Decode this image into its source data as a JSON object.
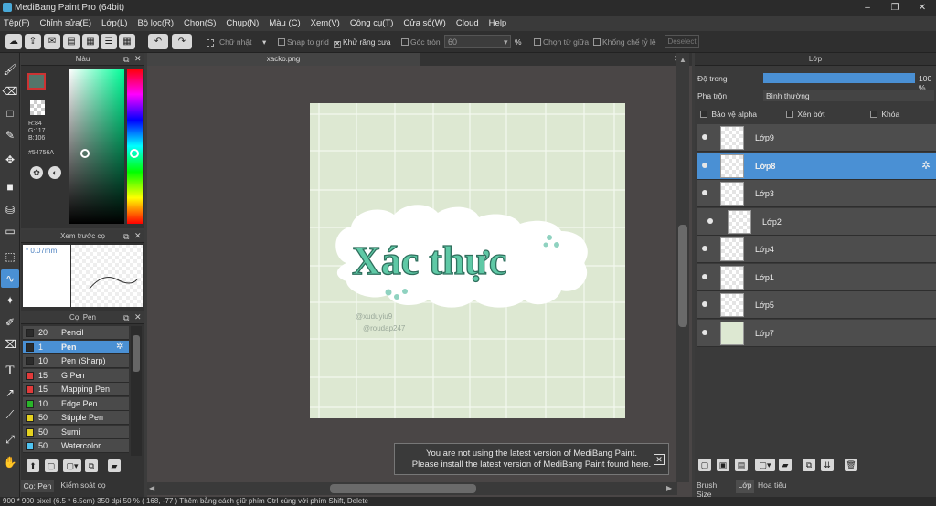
{
  "window": {
    "title": "MediBang Paint Pro (64bit)"
  },
  "menu": [
    "Tệp(F)",
    "Chỉnh sửa(E)",
    "Lớp(L)",
    "Bộ lọc(R)",
    "Chọn(S)",
    "Chụp(N)",
    "Màu (C)",
    "Xem(V)",
    "Công cụ(T)",
    "Cửa sổ(W)",
    "Cloud",
    "Help"
  ],
  "toolbar": {
    "shape": "Chữ nhật",
    "snap": "Snap to grid",
    "antialias": "Khử răng cưa",
    "corner": "Góc tròn",
    "corner_value": "60",
    "corner_unit": "%",
    "center": "Chọn từ giữa",
    "ratio": "Khống chế tỷ lệ",
    "deselect": "Deselect"
  },
  "color_panel": {
    "title": "Màu",
    "r": "R:84",
    "g": "G:117",
    "b": "B:106",
    "hex": "#54756A",
    "current_color": "#54756a"
  },
  "preview_panel": {
    "title": "Xem trước cọ",
    "size": "0.07mm"
  },
  "brush_panel": {
    "title": "Cọ: Pen",
    "brushes": [
      {
        "size": "20",
        "name": "Pencil",
        "color": "#2b2b2b"
      },
      {
        "size": "1",
        "name": "Pen",
        "color": "#2b2b2b",
        "selected": true
      },
      {
        "size": "10",
        "name": "Pen (Sharp)",
        "color": "#2b2b2b"
      },
      {
        "size": "15",
        "name": "G Pen",
        "color": "#e23a3a"
      },
      {
        "size": "15",
        "name": "Mapping Pen",
        "color": "#e23a3a"
      },
      {
        "size": "10",
        "name": "Edge Pen",
        "color": "#29b529"
      },
      {
        "size": "50",
        "name": "Stipple Pen",
        "color": "#e5d21f"
      },
      {
        "size": "50",
        "name": "Sumi",
        "color": "#e5d21f"
      },
      {
        "size": "50",
        "name": "Watercolor",
        "color": "#4fc3f0"
      }
    ],
    "tabs": [
      "Cọ: Pen",
      "Kiểm soát cọ"
    ]
  },
  "canvas": {
    "tab": "xacko.png",
    "artwork_text": "Xác thực",
    "handles": [
      "@xuduyiu9",
      "@roudap247"
    ],
    "notice_line1": "You are not using the latest version of MediBang Paint.",
    "notice_line2": "Please install the latest version of MediBang Paint found here."
  },
  "layer_panel": {
    "title": "Lớp",
    "opacity_label": "Độ trong",
    "opacity_value": "100 %",
    "opacity": 1.0,
    "blend_label": "Pha trộn",
    "blend_value": "Bình thường",
    "protect_alpha": "Bảo vệ alpha",
    "clipping": "Xén bớt",
    "lock": "Khóa",
    "layers": [
      {
        "name": "Lớp9"
      },
      {
        "name": "Lớp8",
        "selected": true
      },
      {
        "name": "Lớp3"
      },
      {
        "name": "Lớp2"
      },
      {
        "name": "Lớp4"
      },
      {
        "name": "Lớp1"
      },
      {
        "name": "Lớp5"
      },
      {
        "name": "Lớp7"
      }
    ],
    "tabs": [
      "Brush Size",
      "Lớp",
      "Hoa tiêu"
    ]
  },
  "status": {
    "text": "900 * 900 pixel   (6.5 * 6.5cm)   350 dpi   50 %   ( 168, -77 )   Thêm bằng cách giữ phím Ctrl cùng với phím Shift, Delete"
  }
}
